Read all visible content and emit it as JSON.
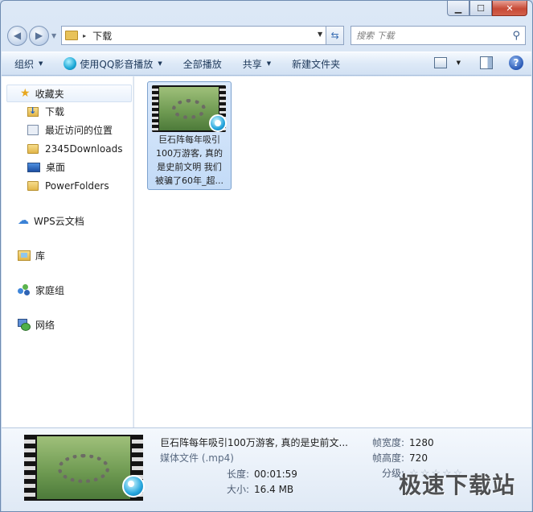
{
  "window": {
    "minimize_glyph": "▁",
    "maximize_glyph": "☐",
    "close_glyph": "✕"
  },
  "nav": {
    "back_glyph": "◀",
    "forward_glyph": "▶",
    "address_path": "下载",
    "address_separator": "▸",
    "search_placeholder": "搜索 下载"
  },
  "toolbar": {
    "organize": "组织",
    "play_with_qq": "使用QQ影音播放",
    "play_all": "全部播放",
    "share": "共享",
    "new_folder": "新建文件夹",
    "help": "?"
  },
  "sidebar": {
    "favorites": "收藏夹",
    "favorites_items": [
      {
        "label": "下载",
        "icon": "download-folder-icon"
      },
      {
        "label": "最近访问的位置",
        "icon": "recent-places-icon"
      },
      {
        "label": "2345Downloads",
        "icon": "folder-icon"
      },
      {
        "label": "桌面",
        "icon": "desktop-icon"
      },
      {
        "label": "PowerFolders",
        "icon": "folder-icon"
      }
    ],
    "groups": [
      {
        "label": "WPS云文档",
        "icon": "cloud-icon"
      },
      {
        "label": "库",
        "icon": "library-icon"
      },
      {
        "label": "家庭组",
        "icon": "homegroup-icon"
      },
      {
        "label": "网络",
        "icon": "network-icon"
      }
    ]
  },
  "files": [
    {
      "caption_lines": [
        "巨石阵每年吸引",
        "100万游客, 真的",
        "是史前文明 我们",
        "被骗了60年_超..."
      ],
      "icon": "video-file-icon"
    }
  ],
  "details": {
    "title": "巨石阵每年吸引100万游客, 真的是史前文...",
    "type": "媒体文件 (.mp4)",
    "length_label": "长度:",
    "length_value": "00:01:59",
    "size_label": "大小:",
    "size_value": "16.4 MB",
    "width_label": "帧宽度:",
    "width_value": "1280",
    "height_label": "帧高度:",
    "height_value": "720",
    "rating_label": "分级:",
    "rating_stars": "☆☆☆☆☆",
    "rating_value": 0
  },
  "watermark": "极速下载站",
  "colors": {
    "accent": "#3b6fb4",
    "selection": "#c3dbf7",
    "close_button": "#c74a36"
  }
}
